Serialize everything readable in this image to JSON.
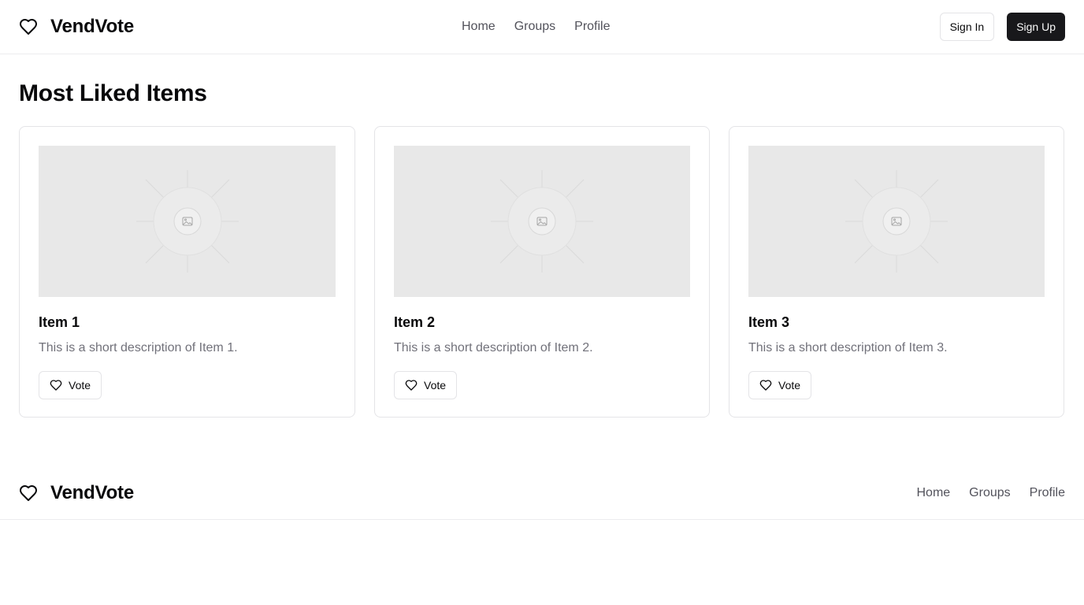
{
  "header": {
    "brand": "VendVote",
    "nav": [
      "Home",
      "Groups",
      "Profile"
    ],
    "sign_in": "Sign In",
    "sign_up": "Sign Up"
  },
  "main": {
    "title": "Most Liked Items",
    "items": [
      {
        "title": "Item 1",
        "description": "This is a short description of Item 1.",
        "vote_label": "Vote"
      },
      {
        "title": "Item 2",
        "description": "This is a short description of Item 2.",
        "vote_label": "Vote"
      },
      {
        "title": "Item 3",
        "description": "This is a short description of Item 3.",
        "vote_label": "Vote"
      }
    ]
  },
  "footer": {
    "brand": "VendVote",
    "nav": [
      "Home",
      "Groups",
      "Profile"
    ]
  },
  "icons": {
    "brand": "heart-icon",
    "vote": "heart-icon",
    "placeholder": "image-placeholder-icon"
  },
  "colors": {
    "primary_button": "#18181b",
    "muted_text": "#71717a",
    "nav_text": "#52525b",
    "border": "#e4e4e7",
    "placeholder_bg": "#e8e8e8"
  }
}
